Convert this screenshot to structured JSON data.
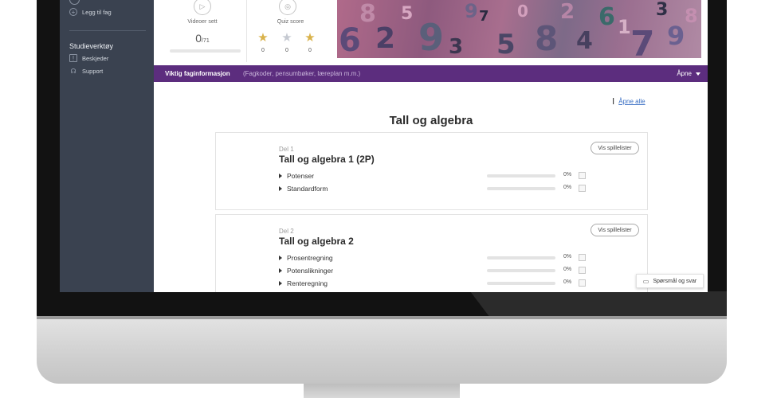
{
  "sidebar": {
    "add_subject_label": "Legg til fag",
    "tools_heading": "Studieverktøy",
    "items": [
      {
        "label": "Beskjeder",
        "icon": "message-icon"
      },
      {
        "label": "Support",
        "icon": "headset-icon"
      }
    ]
  },
  "stats": {
    "videos": {
      "label": "Videoer sett",
      "count": "0",
      "total": "/71",
      "progress": 0
    },
    "quiz": {
      "label": "Quiz score",
      "stars": [
        {
          "icon": "gold-star-icon",
          "count": "0"
        },
        {
          "icon": "silver-star-icon",
          "count": "0"
        },
        {
          "icon": "gold-star-icon",
          "count": "0"
        }
      ]
    }
  },
  "info_bar": {
    "title": "Viktig faginformasjon",
    "subtitle": "(Fagkoder, pensumbøker, læreplan m.m.)",
    "open_label": "Åpne"
  },
  "main": {
    "open_all_label": "Åpne alle",
    "section_title": "Tall og algebra",
    "parts": [
      {
        "part_label": "Del 1",
        "title": "Tall og algebra 1 (2P)",
        "playlist_button": "Vis spillelister",
        "topics": [
          {
            "label": "Potenser",
            "percent": "0%",
            "progress": 0
          },
          {
            "label": "Standardform",
            "percent": "0%",
            "progress": 0
          }
        ]
      },
      {
        "part_label": "Del 2",
        "title": "Tall og algebra 2",
        "playlist_button": "Vis spillelister",
        "topics": [
          {
            "label": "Prosentregning",
            "percent": "0%",
            "progress": 0
          },
          {
            "label": "Potenslikninger",
            "percent": "0%",
            "progress": 0
          },
          {
            "label": "Renteregning",
            "percent": "0%",
            "progress": 0
          }
        ]
      }
    ]
  },
  "qa_button_label": "Spørsmål og svar",
  "colors": {
    "accent_purple": "#5c2d7e",
    "sidebar_bg": "#3a4250",
    "link_blue": "#3a6fc4"
  }
}
